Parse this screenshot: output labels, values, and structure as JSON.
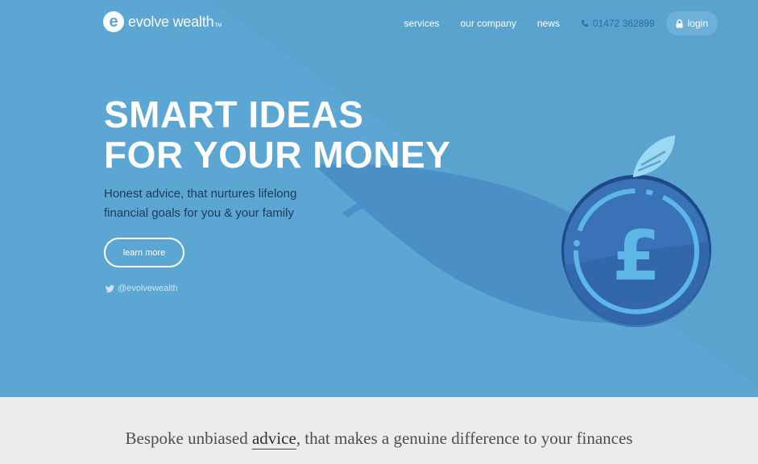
{
  "brand": {
    "name": "evolve wealth",
    "tm": "TM",
    "mark": "e"
  },
  "nav": {
    "links": [
      "services",
      "our company",
      "news"
    ],
    "phone": "01472 362899",
    "login": "login"
  },
  "hero": {
    "headline_1": "SMART IDEAS",
    "headline_2": "FOR YOUR MONEY",
    "sub_1": "Honest advice, that nurtures lifelong",
    "sub_2": "financial goals for you & your family",
    "cta": "learn more",
    "twitter": "@evolvewealth",
    "coin_symbol": "£"
  },
  "tagline": {
    "before": "Bespoke unbiased ",
    "highlight": "advice",
    "after": ", that makes a genuine difference to your finances"
  },
  "colors": {
    "hero_bg": "#5aa3ce",
    "shadow": "#4a8fc6",
    "coin": "#3a72b8",
    "coin_rim": "#1e4a8a",
    "coin_symbol": "#5cb6e6",
    "leaf": "#9bd8f2",
    "page_bg": "#ececec"
  }
}
